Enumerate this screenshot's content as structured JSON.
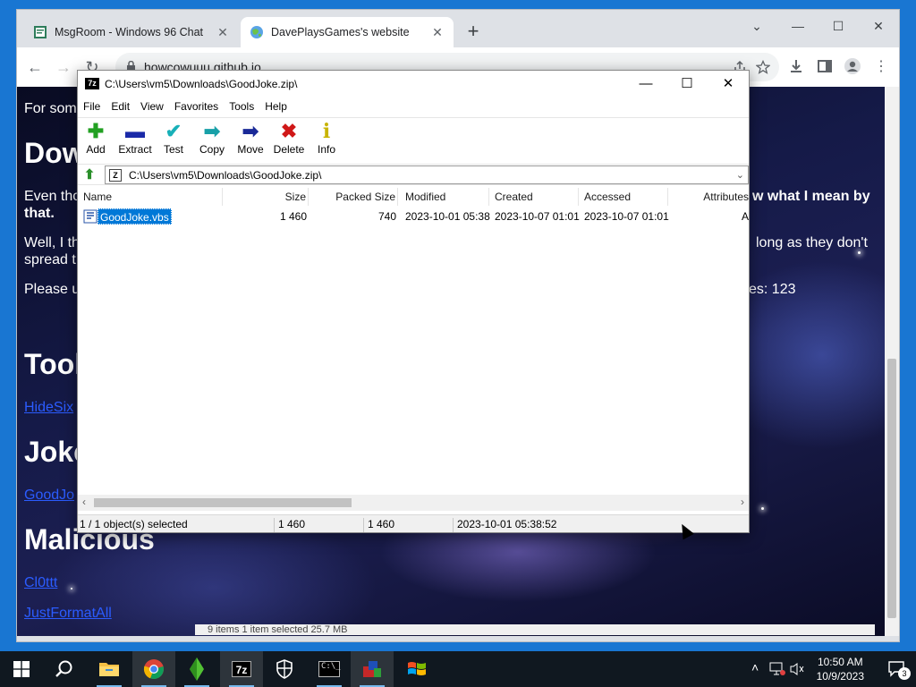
{
  "browser": {
    "tabs": [
      {
        "title": "MsgRoom - Windows 96 Chat"
      },
      {
        "title": "DavePlaysGames's website"
      }
    ],
    "new_tab": "+",
    "close_glyph": "✕",
    "url": "howcowuuu.github.io",
    "window_controls": {
      "minimize": "—",
      "maximize": "☐",
      "close": "✕",
      "dropdown": "⌄"
    }
  },
  "page": {
    "line1": "For som",
    "heading_download": "Dow",
    "para_even": "Even tho",
    "para_even_right": "w what I mean by",
    "para_even_2": "that.",
    "para_well": "Well, I th",
    "para_well_right": "long as they don't",
    "para_well_2": "spread t",
    "para_please": "Please u",
    "para_please_right": "es: 123",
    "heading_tools": "Tool",
    "link_tools": "HideSix",
    "heading_jokes": "Joke",
    "link_jokes": "GoodJo",
    "heading_malicious": "Malicious",
    "link_mal1": "Cl0ttt",
    "link_mal2": "JustFormatAll",
    "behind_status": "9 items     1 item selected  25.7 MB"
  },
  "sevenzip": {
    "title": "C:\\Users\\vm5\\Downloads\\GoodJoke.zip\\",
    "app_icon": "7z",
    "menu": [
      "File",
      "Edit",
      "View",
      "Favorites",
      "Tools",
      "Help"
    ],
    "toolbar": [
      {
        "label": "Add",
        "icon": "add-icon",
        "color": "#22a022"
      },
      {
        "label": "Extract",
        "icon": "extract-icon",
        "color": "#1a2aa8"
      },
      {
        "label": "Test",
        "icon": "test-icon",
        "color": "#18b0b8"
      },
      {
        "label": "Copy",
        "icon": "copy-icon",
        "color": "#18a0a8"
      },
      {
        "label": "Move",
        "icon": "move-icon",
        "color": "#1a2a98"
      },
      {
        "label": "Delete",
        "icon": "delete-icon",
        "color": "#d01818"
      },
      {
        "label": "Info",
        "icon": "info-icon",
        "color": "#c8b400"
      }
    ],
    "address": "C:\\Users\\vm5\\Downloads\\GoodJoke.zip\\",
    "columns": [
      "Name",
      "Size",
      "Packed Size",
      "Modified",
      "Created",
      "Accessed",
      "Attributes"
    ],
    "rows": [
      {
        "name": "GoodJoke.vbs",
        "size": "1 460",
        "packed": "740",
        "modified": "2023-10-01 05:38",
        "created": "2023-10-07 01:01",
        "accessed": "2023-10-07 01:01",
        "attributes": "A"
      }
    ],
    "status": {
      "selected": "1 / 1 object(s) selected",
      "size": "1 460",
      "packed": "1 460",
      "modified": "2023-10-01 05:38:52"
    }
  },
  "taskbar": {
    "time": "10:50 AM",
    "date": "10/9/2023",
    "notifications": "3"
  }
}
